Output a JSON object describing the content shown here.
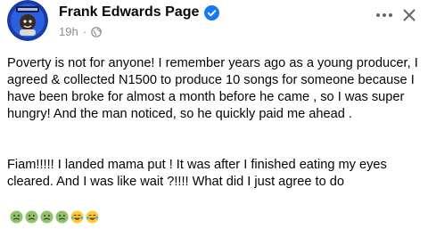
{
  "post": {
    "author_name": "Frank Edwards Page",
    "timestamp": "19h",
    "separator": "·",
    "paragraph_1": "Poverty is not for anyone! I remember years ago as a young producer, I agreed & collected  N1500  to produce 10 songs for someone because I have been broke for almost a month before he came , so I was super hungry! And the man noticed, so he quickly paid me ahead .",
    "paragraph_2": "Fiam!!!!!  I landed mama put ! It was after I finished eating my eyes cleared. And I was like wait  ?!!!! What did I just agree to do",
    "emojis": [
      "nauseated-face",
      "nauseated-face",
      "nauseated-face",
      "nauseated-face",
      "face-with-tears-of-joy",
      "face-with-tears-of-joy"
    ]
  },
  "colors": {
    "verified_badge": "#1877f2",
    "meta_text": "#8a8d91",
    "icon_grey": "#606770",
    "nauseated": "#8fc36b",
    "joy": "#ffcc33"
  }
}
